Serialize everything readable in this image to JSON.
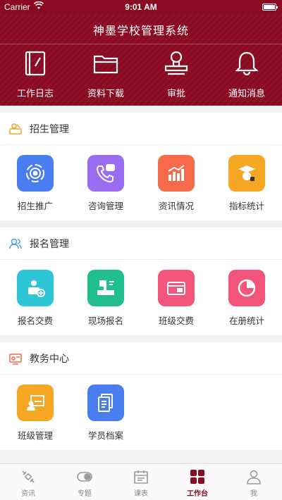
{
  "status_bar": {
    "carrier": "Carrier",
    "time": "9:01 AM"
  },
  "app_title": "神墨学校管理系统",
  "quick_actions": [
    {
      "label": "工作日志",
      "icon": "notebook-icon"
    },
    {
      "label": "资料下载",
      "icon": "folder-icon"
    },
    {
      "label": "审批",
      "icon": "stamp-icon"
    },
    {
      "label": "通知消息",
      "icon": "bell-icon"
    }
  ],
  "sections": [
    {
      "title": "招生管理",
      "icon": "enrollment-icon",
      "items": [
        {
          "label": "招生推广",
          "icon": "target-icon",
          "color": "#4a7ef0"
        },
        {
          "label": "咨询管理",
          "icon": "phone-chat-icon",
          "color": "#9a6cf0"
        },
        {
          "label": "资讯情况",
          "icon": "bar-chart-icon",
          "color": "#f46a4a"
        },
        {
          "label": "指标统计",
          "icon": "graduate-icon",
          "color": "#f5a623"
        }
      ]
    },
    {
      "title": "报名管理",
      "icon": "users-icon",
      "items": [
        {
          "label": "报名交费",
          "icon": "register-pay-icon",
          "color": "#2ec5d6"
        },
        {
          "label": "现场报名",
          "icon": "onsite-register-icon",
          "color": "#1fbf8f"
        },
        {
          "label": "班级交费",
          "icon": "card-icon",
          "color": "#f3557a"
        },
        {
          "label": "在册统计",
          "icon": "pie-chart-icon",
          "color": "#f3557a"
        }
      ]
    },
    {
      "title": "教务中心",
      "icon": "academic-icon",
      "items": [
        {
          "label": "班级管理",
          "icon": "classroom-icon",
          "color": "#f5a623"
        },
        {
          "label": "学员档案",
          "icon": "documents-icon",
          "color": "#4a7ef0"
        }
      ]
    }
  ],
  "tabbar": [
    {
      "label": "资讯",
      "icon": "satellite-icon",
      "active": false
    },
    {
      "label": "专题",
      "icon": "toggle-icon",
      "active": false
    },
    {
      "label": "课表",
      "icon": "calendar-icon",
      "active": false
    },
    {
      "label": "工作台",
      "icon": "grid-icon",
      "active": true
    },
    {
      "label": "我",
      "icon": "person-icon",
      "active": false
    }
  ],
  "colors": {
    "brand": "#8a0a22",
    "background": "#f2f2f2"
  }
}
